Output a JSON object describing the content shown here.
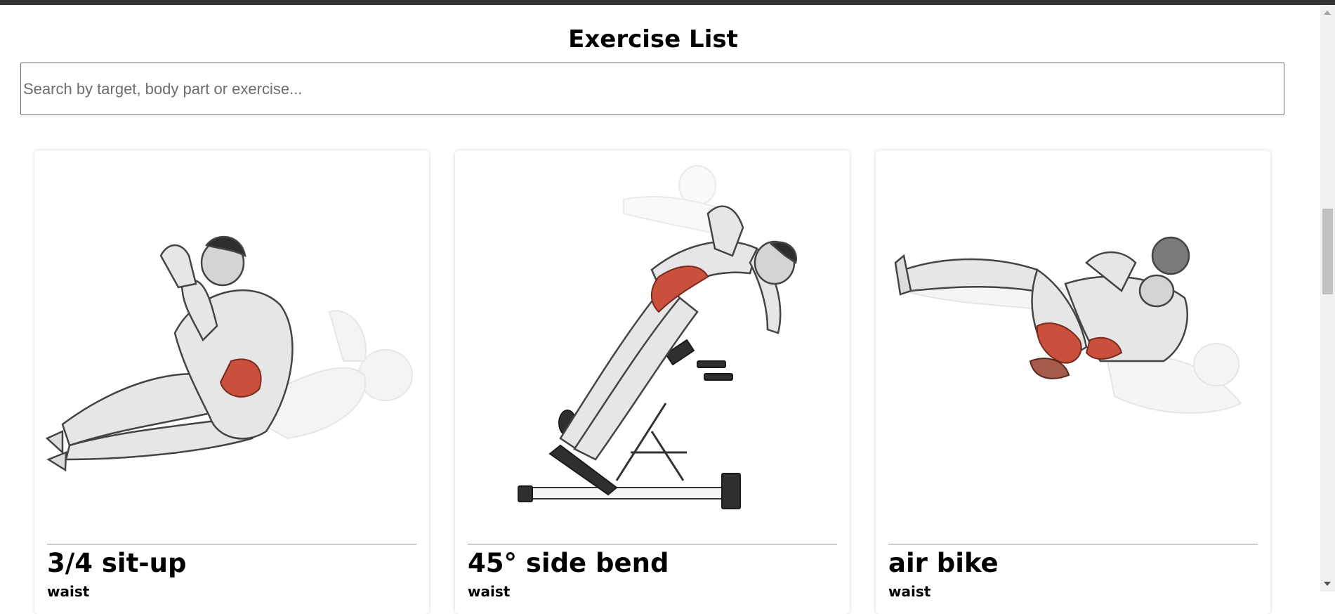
{
  "page": {
    "title": "Exercise List"
  },
  "search": {
    "placeholder": "Search by target, body part or exercise...",
    "value": ""
  },
  "exercises": [
    {
      "name": "3/4 sit-up",
      "body_part": "waist",
      "illustration": "sit-up-figure"
    },
    {
      "name": "45° side bend",
      "body_part": "waist",
      "illustration": "side-bend-bench-figure"
    },
    {
      "name": "air bike",
      "body_part": "waist",
      "illustration": "air-bike-crunch-figure"
    }
  ],
  "colors": {
    "top_bar": "#333333",
    "highlight_muscle": "#c9503c",
    "scrollbar_thumb": "#c1c1c1"
  }
}
